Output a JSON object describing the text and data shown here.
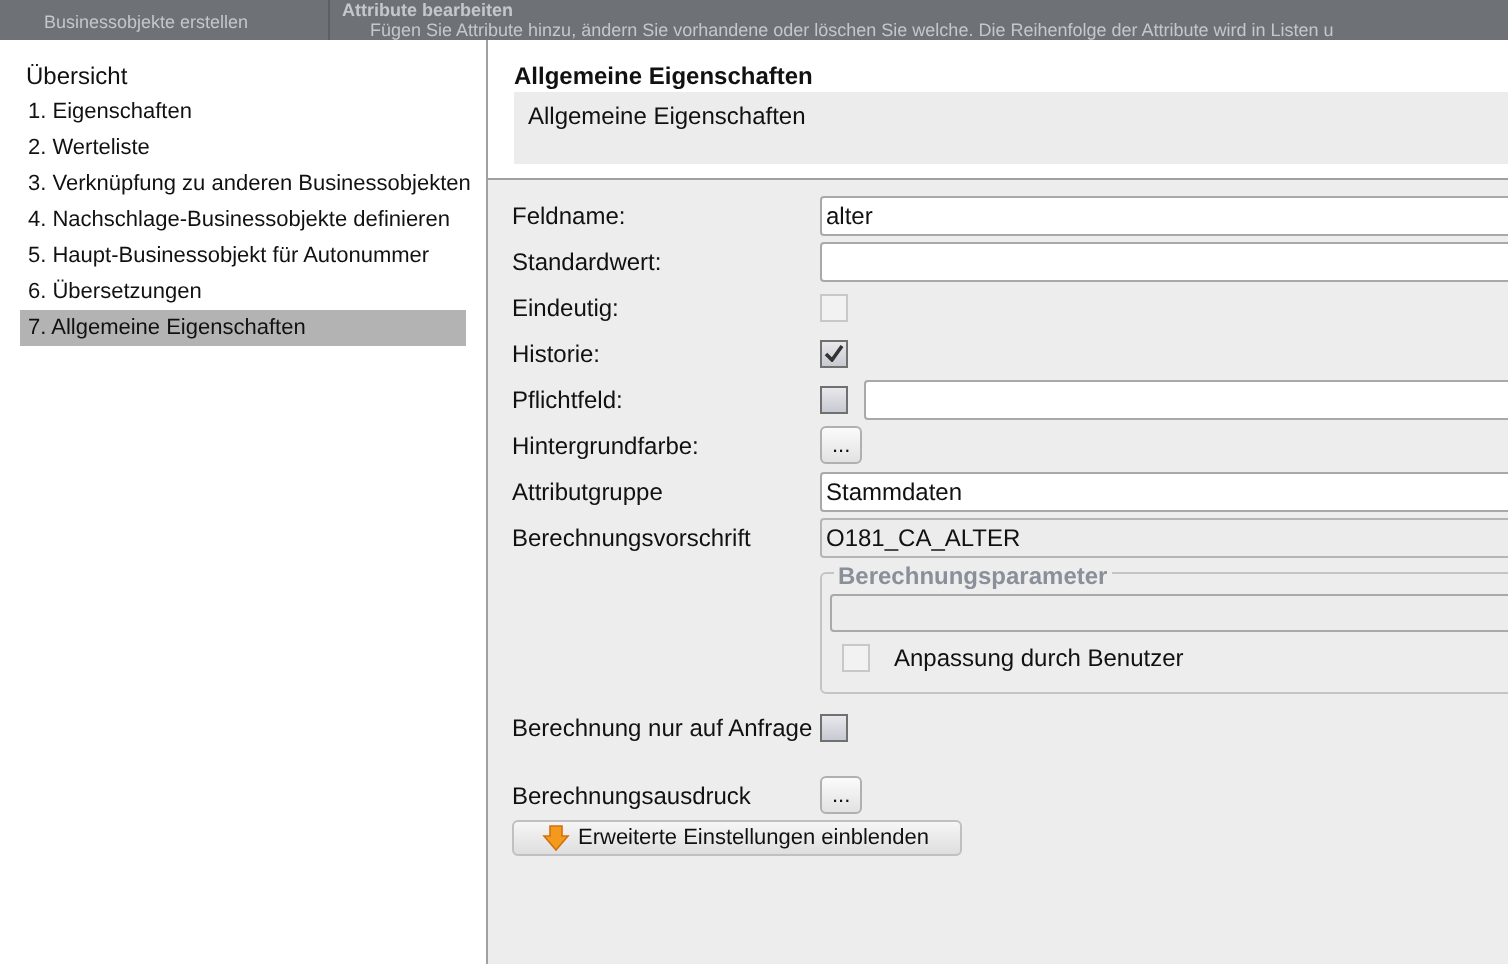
{
  "background": {
    "left_text": "Businessobjekte erstellen",
    "title": "Attribute bearbeiten",
    "description": "Fügen Sie Attribute hinzu, ändern Sie vorhandene oder löschen Sie welche. Die Reihenfolge der Attribute wird in Listen u"
  },
  "nav": {
    "title": "Übersicht",
    "items": [
      {
        "label": "1. Eigenschaften",
        "selected": false
      },
      {
        "label": "2. Werteliste",
        "selected": false
      },
      {
        "label": "3. Verknüpfung zu anderen Businessobjekten",
        "selected": false
      },
      {
        "label": "4. Nachschlage-Businessobjekte definieren",
        "selected": false
      },
      {
        "label": "5. Haupt-Businessobjekt für Autonummer",
        "selected": false
      },
      {
        "label": "6. Übersetzungen",
        "selected": false
      },
      {
        "label": "7. Allgemeine Eigenschaften",
        "selected": true
      }
    ]
  },
  "header": {
    "title": "Allgemeine Eigenschaften",
    "description": "Allgemeine Eigenschaften"
  },
  "fields": [
    {
      "kind": "text",
      "label": "Feldname:",
      "value": "alter",
      "disabled": false
    },
    {
      "kind": "text",
      "label": "Standardwert:",
      "disabled": false
    },
    {
      "kind": "checkbox",
      "label": "Eindeutig:",
      "checked": false,
      "disabled": true
    },
    {
      "kind": "checkbox",
      "label": "Historie:",
      "checked": true,
      "disabled": false
    },
    {
      "kind": "checkbox_text",
      "label": "Pflichtfeld:",
      "checked": false,
      "disabled": false
    },
    {
      "kind": "ellipsis",
      "label": "Hintergrundfarbe:",
      "button": "..."
    },
    {
      "kind": "text",
      "label": "Attributgruppe",
      "value": "Stammdaten",
      "disabled": false
    },
    {
      "kind": "text",
      "label": "Berechnungsvorschrift",
      "value": "O181_CA_ALTER",
      "disabled": true
    }
  ],
  "group": {
    "title": "Berechnungsparameter",
    "checkbox": {
      "label": "Anpassung durch Benutzer",
      "checked": false,
      "disabled": true
    }
  },
  "fields_after": [
    {
      "kind": "checkbox",
      "label": "Berechnung nur auf Anfrage",
      "checked": false,
      "disabled": false
    },
    {
      "kind": "ellipsis",
      "label": "Berechnungsausdruck",
      "button": "..."
    }
  ],
  "advanced_button": "Erweiterte Einstellungen einblenden"
}
